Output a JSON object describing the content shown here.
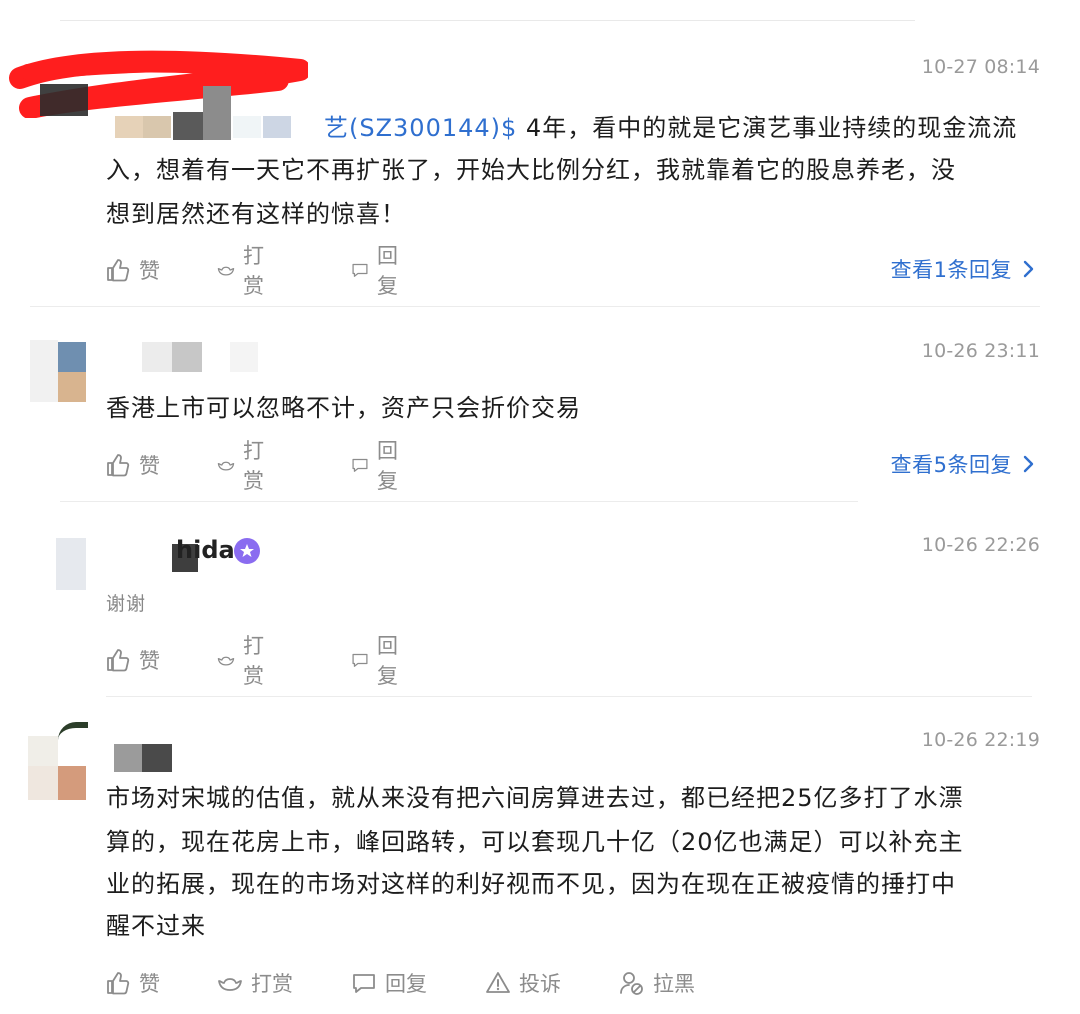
{
  "comments": [
    {
      "time": "10-27 08:14",
      "stock_tag": "艺(SZ300144)$",
      "text_after_tag": " 4年，看中的就是它演艺事业持续的现金流流",
      "lines": [
        "入，想着有一天它不再扩张了，开始大比例分红，我就靠着它的股息养老，没",
        "想到居然还有这样的惊喜！"
      ],
      "reply_link": "查看1条回复"
    },
    {
      "time": "10-26 23:11",
      "lines": [
        "香港上市可以忽略不计，资产只会折价交易"
      ],
      "reply_link": "查看5条回复"
    },
    {
      "time": "10-26 22:26",
      "username_partial": "hida",
      "lines": [
        "谢谢"
      ]
    },
    {
      "time": "10-26 22:19",
      "lines": [
        "市场对宋城的估值，就从来没有把六间房算进去过，都已经把25亿多打了水漂",
        "算的，现在花房上市，峰回路转，可以套现几十亿（20亿也满足）可以补充主",
        "业的拓展，现在的市场对这样的利好视而不见，因为在现在正被疫情的捶打中",
        "醒不过来"
      ]
    }
  ],
  "actions": {
    "like": "赞",
    "tip": "打赏",
    "reply": "回复",
    "report": "投诉",
    "block": "拉黑"
  },
  "colors": {
    "link": "#2f6fcf",
    "muted": "#8c8c8c",
    "redaction": "#ff1e1e"
  }
}
